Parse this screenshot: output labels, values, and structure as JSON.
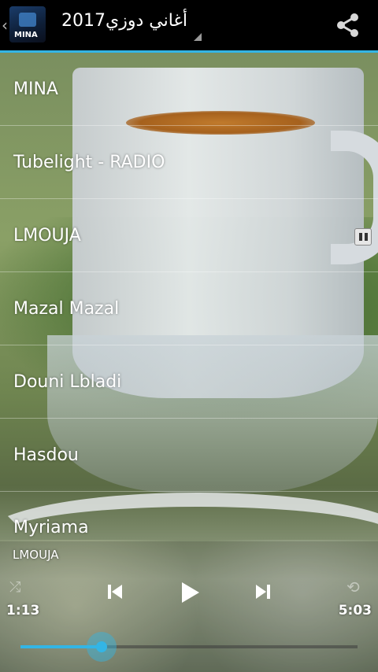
{
  "app": {
    "title": "أغاني دوزي2017",
    "logo_text": "MINA"
  },
  "songs": [
    {
      "title": "MINA",
      "playing": false
    },
    {
      "title": "Tubelight - RADIO",
      "playing": false
    },
    {
      "title": "LMOUJA",
      "playing": true
    },
    {
      "title": "Mazal Mazal",
      "playing": false
    },
    {
      "title": "Douni Lbladi",
      "playing": false
    },
    {
      "title": "Hasdou",
      "playing": false
    },
    {
      "title": "Myriama",
      "playing": false
    }
  ],
  "player": {
    "now_playing": "LMOUJA",
    "elapsed": "1:13",
    "duration": "5:03",
    "progress": 0.24
  },
  "icons": {
    "back": "chevron-left-icon",
    "share": "share-icon",
    "shuffle": "shuffle-icon",
    "prev": "skip-previous-icon",
    "play": "play-icon",
    "next": "skip-next-icon",
    "repeat": "repeat-icon",
    "pause_indicator": "pause-icon"
  },
  "colors": {
    "accent": "#33b5e5",
    "bar_bg": "#000000",
    "text": "#ffffff"
  }
}
